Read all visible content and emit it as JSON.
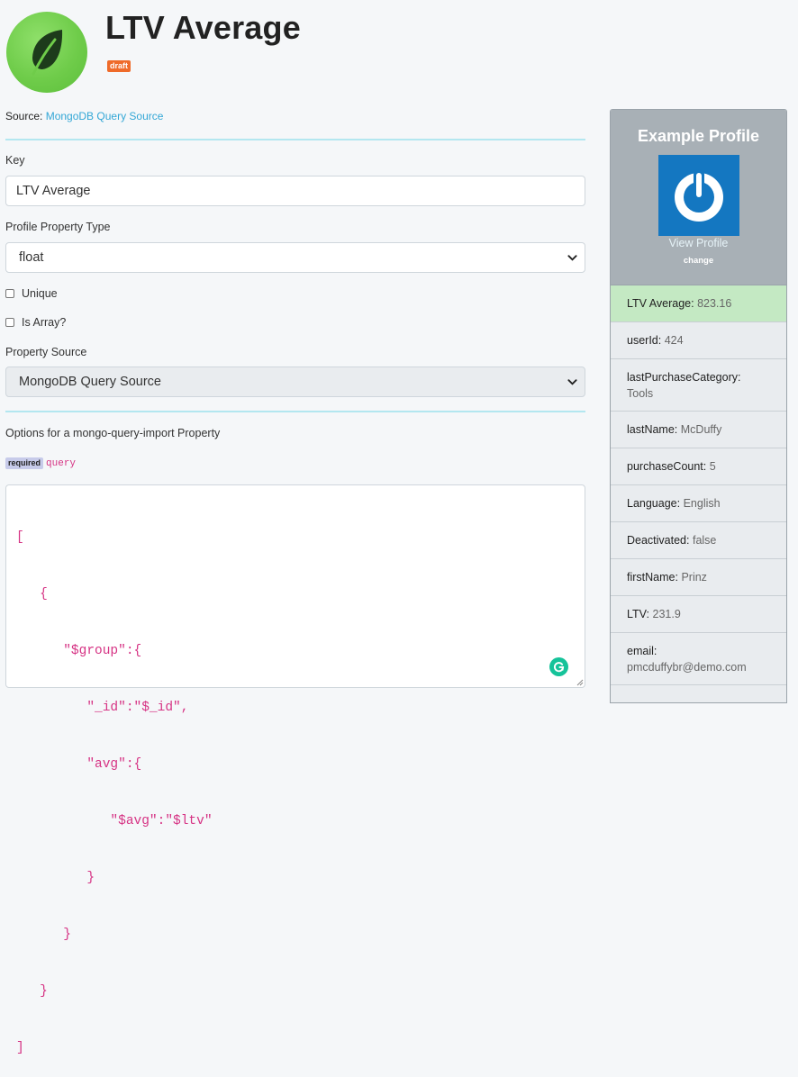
{
  "header": {
    "title": "LTV Average",
    "status_badge": "draft",
    "logo_icon": "leaf-icon"
  },
  "source": {
    "label": "Source:",
    "link": "MongoDB Query Source"
  },
  "form": {
    "key_label": "Key",
    "key_value": "LTV Average",
    "type_label": "Profile Property Type",
    "type_value": "float",
    "unique_label": "Unique",
    "unique_checked": false,
    "is_array_label": "Is Array?",
    "is_array_checked": false,
    "property_source_label": "Property Source",
    "property_source_value": "MongoDB Query Source",
    "options_label": "Options for a mongo-query-import Property",
    "required_badge": "required",
    "query_field": "query",
    "query_lines": [
      "[",
      "   {",
      "      \"$group\":{",
      "         \"_id\":\"$_id\",",
      "         \"avg\":{",
      "            \"$avg\":\"$ltv\"",
      "         }",
      "      }",
      "   }",
      "]"
    ]
  },
  "example_profile": {
    "title": "Example Profile",
    "view_profile_label": "View Profile",
    "change_label": "change",
    "avatar_icon": "power-icon",
    "properties": [
      {
        "key": "LTV Average",
        "value": "823.16",
        "highlight": true
      },
      {
        "key": "userId",
        "value": "424"
      },
      {
        "key": "lastPurchaseCategory",
        "value": "Tools"
      },
      {
        "key": "lastName",
        "value": "McDuffy"
      },
      {
        "key": "purchaseCount",
        "value": "5"
      },
      {
        "key": "Language",
        "value": "English"
      },
      {
        "key": "Deactivated",
        "value": "false"
      },
      {
        "key": "firstName",
        "value": "Prinz"
      },
      {
        "key": "LTV",
        "value": "231.9"
      },
      {
        "key": "email",
        "value": "pmcduffybr@demo.com"
      }
    ]
  },
  "colors": {
    "accent_link": "#33a7d6",
    "draft_badge": "#ef6b2a",
    "highlight_row": "#c4e9c3",
    "code_text": "#d63384"
  }
}
